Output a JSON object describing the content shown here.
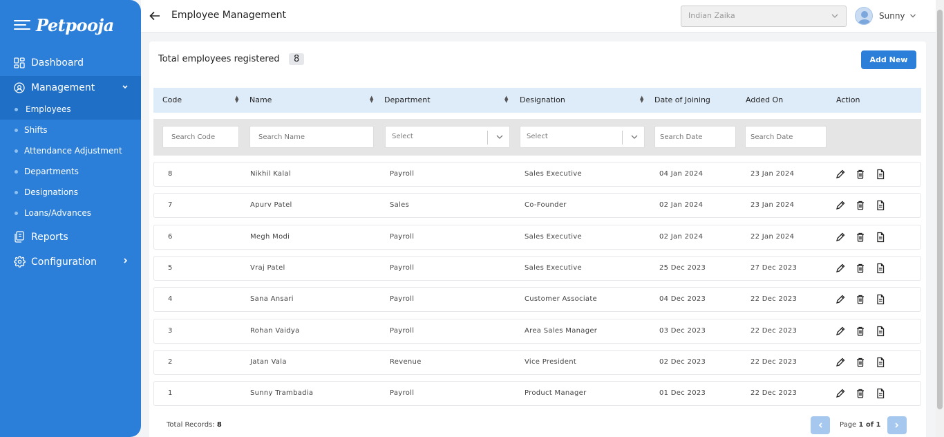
{
  "brand": {
    "name": "Petpooja"
  },
  "sidebar": {
    "items": [
      {
        "label": "Dashboard",
        "icon": "dashboard-icon"
      },
      {
        "label": "Management",
        "icon": "management-icon"
      },
      {
        "label": "Reports",
        "icon": "reports-icon"
      },
      {
        "label": "Configuration",
        "icon": "gear-icon"
      }
    ],
    "subitems": [
      "Employees",
      "Shifts",
      "Attendance Adjustment",
      "Departments",
      "Designations",
      "Loans/Advances"
    ]
  },
  "header": {
    "title": "Employee Management",
    "outlet": "Indian Zaika",
    "user": "Sunny"
  },
  "summary": {
    "label": "Total employees registered",
    "count": "8",
    "add_label": "Add New"
  },
  "table": {
    "columns": [
      "Code",
      "Name",
      "Department",
      "Designation",
      "Date of Joining",
      "Added On",
      "Action"
    ],
    "filters": {
      "code_ph": "Search Code",
      "name_ph": "Search Name",
      "dept": "Select",
      "desig": "Select",
      "doj_ph": "Search Date",
      "added_ph": "Search Date"
    },
    "rows": [
      [
        "8",
        "Nikhil Kalal",
        "Payroll",
        "Sales Executive",
        "04 Jan 2024",
        "23 Jan 2024"
      ],
      [
        "7",
        "Apurv Patel",
        "Sales",
        "Co-Founder",
        "02 Jan 2024",
        "23 Jan 2024"
      ],
      [
        "6",
        "Megh Modi",
        "Payroll",
        "Sales Executive",
        "02 Jan 2024",
        "22 Jan 2024"
      ],
      [
        "5",
        "Vraj Patel",
        "Payroll",
        "Sales Executive",
        "25 Dec 2023",
        "27 Dec 2023"
      ],
      [
        "4",
        "Sana Ansari",
        "Payroll",
        "Customer Associate",
        "04 Dec 2023",
        "22 Dec 2023"
      ],
      [
        "3",
        "Rohan Vaidya",
        "Payroll",
        "Area Sales Manager",
        "03 Dec 2023",
        "22 Dec 2023"
      ],
      [
        "2",
        "Jatan Vala",
        "Revenue",
        "Vice President",
        "02 Dec 2023",
        "22 Dec 2023"
      ],
      [
        "1",
        "Sunny Trambadia",
        "Payroll",
        "Product Manager",
        "01 Dec 2023",
        "22 Dec 2023"
      ]
    ]
  },
  "footer": {
    "records_label": "Total Records:",
    "records": "8",
    "page_label": "Page",
    "page_value": "1 of 1"
  },
  "colors": {
    "primary": "#2c7fd8",
    "header_bg": "#deebf9"
  }
}
